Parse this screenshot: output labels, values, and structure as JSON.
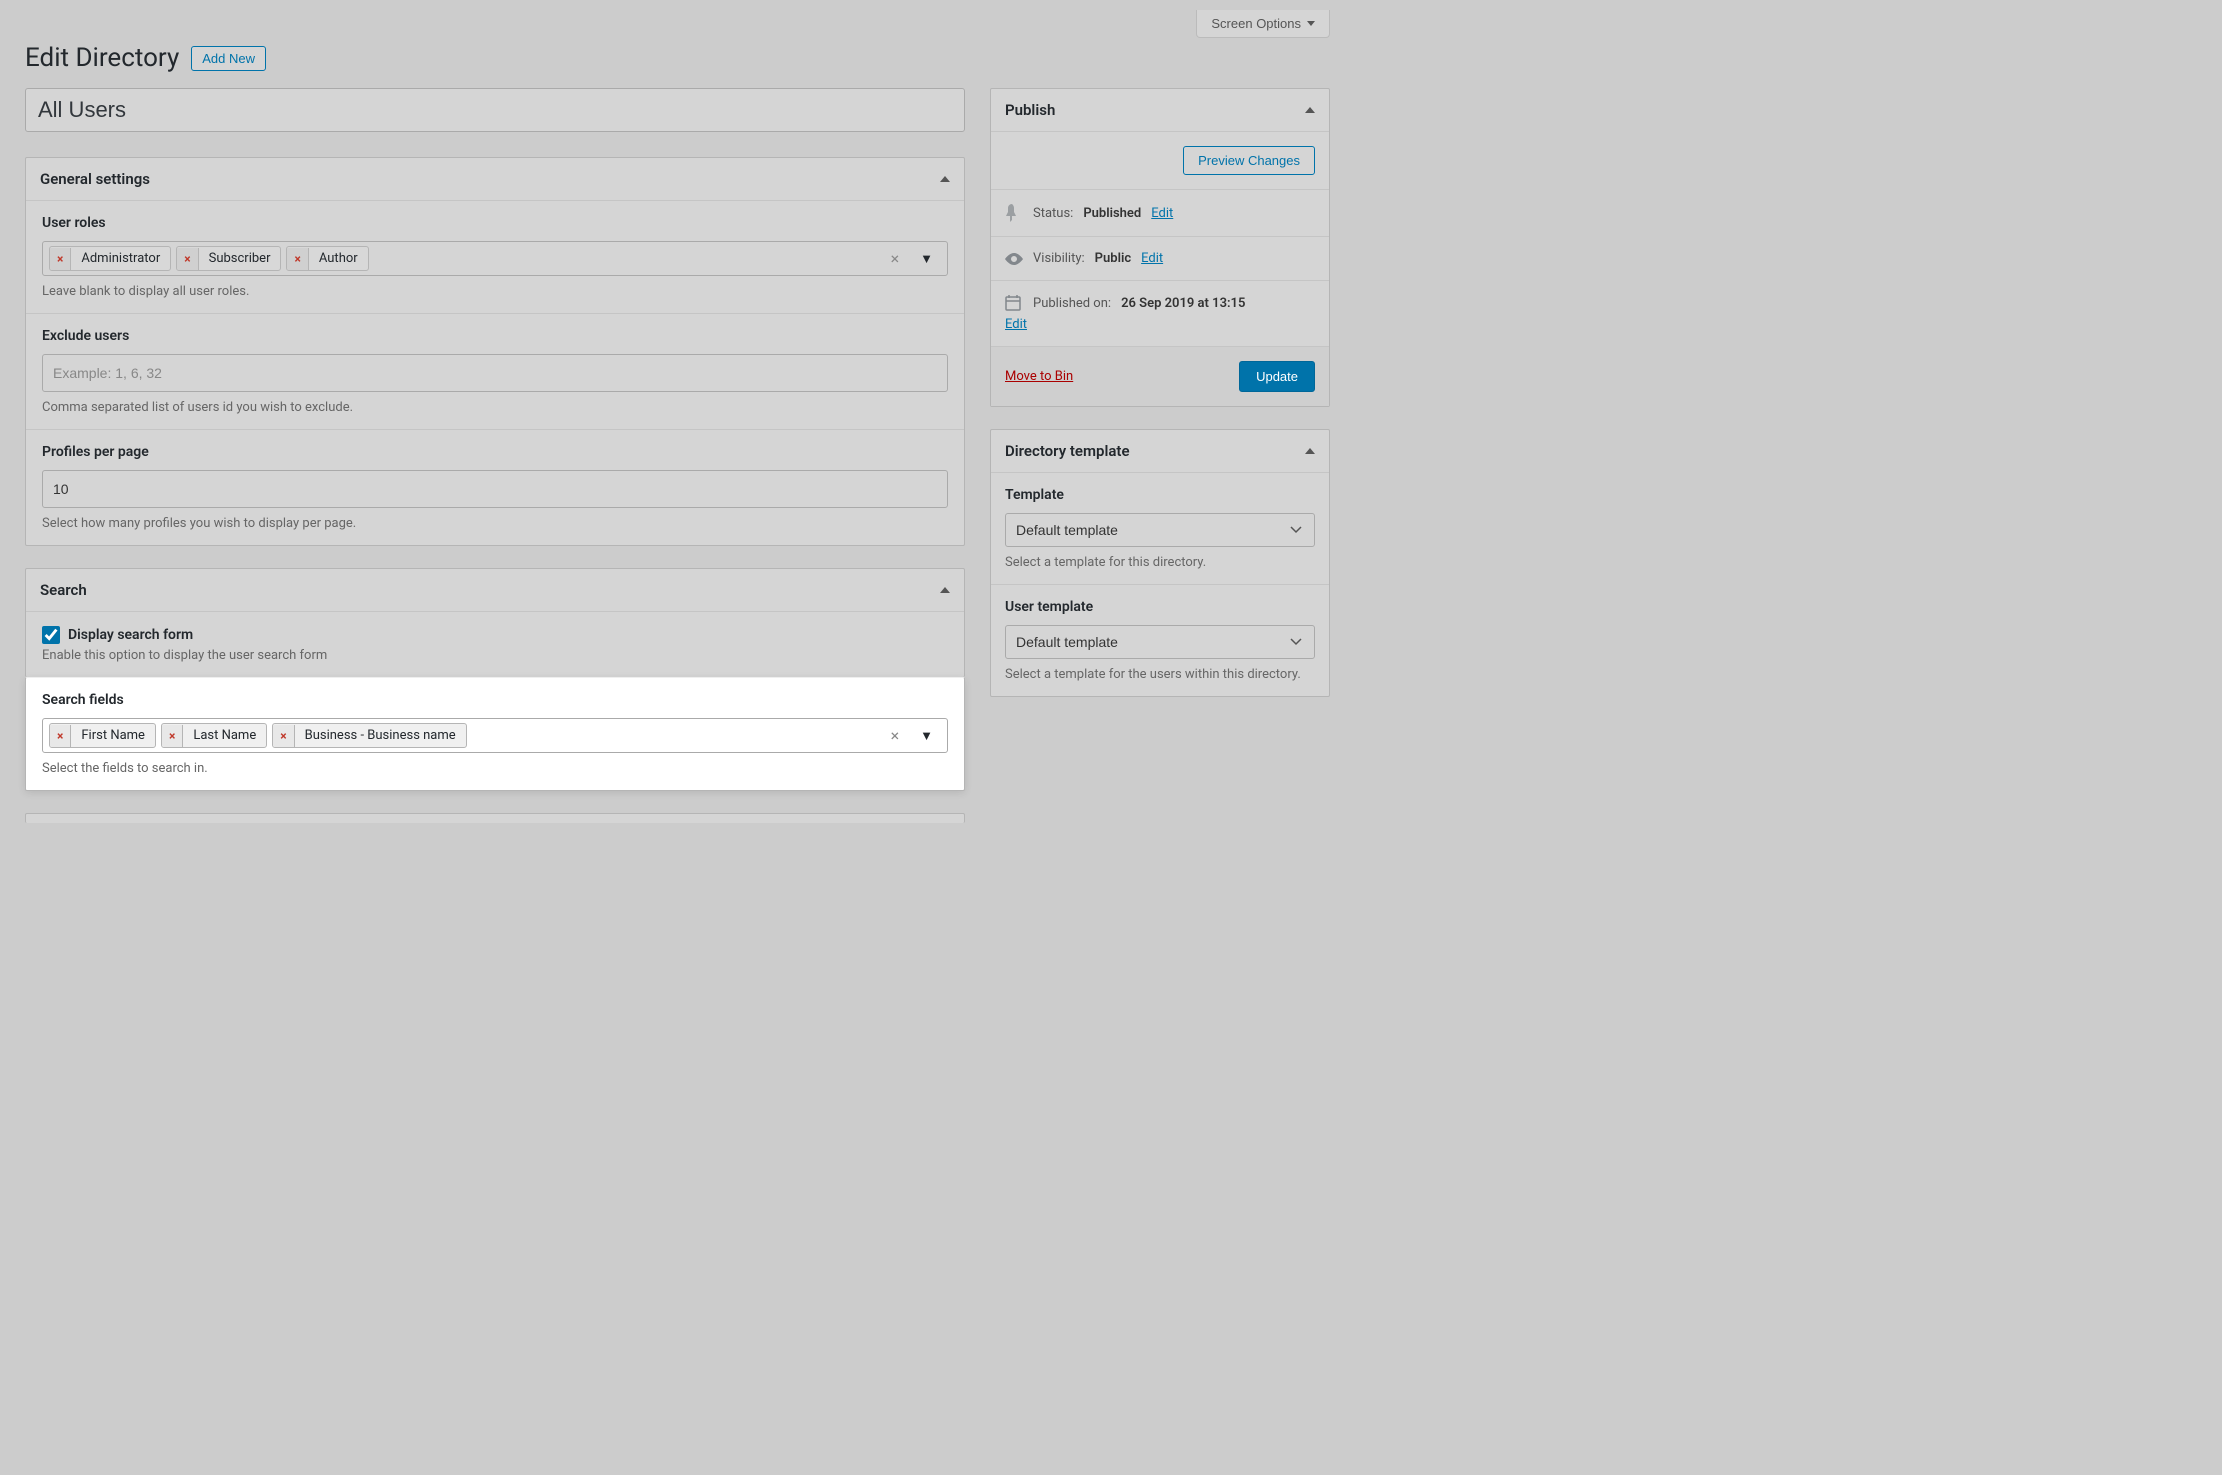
{
  "screen_options": {
    "label": "Screen Options"
  },
  "page_header": {
    "title": "Edit Directory",
    "add_new": "Add New"
  },
  "document_title": "All Users",
  "general_settings": {
    "title": "General settings",
    "user_roles": {
      "label": "User roles",
      "tags": [
        "Administrator",
        "Subscriber",
        "Author"
      ],
      "help": "Leave blank to display all user roles."
    },
    "exclude_users": {
      "label": "Exclude users",
      "placeholder": "Example: 1, 6, 32",
      "value": "",
      "help": "Comma separated list of users id you wish to exclude."
    },
    "profiles_per_page": {
      "label": "Profiles per page",
      "value": "10",
      "help": "Select how many profiles you wish to display per page."
    }
  },
  "search": {
    "title": "Search",
    "display_search_form": {
      "checked": true,
      "label": "Display search form",
      "help": "Enable this option to display the user search form"
    },
    "search_fields": {
      "label": "Search fields",
      "tags": [
        "First Name",
        "Last Name",
        "Business - Business name"
      ],
      "help": "Select the fields to search in."
    }
  },
  "publish": {
    "title": "Publish",
    "preview_changes": "Preview Changes",
    "status_label": "Status:",
    "status_value": "Published",
    "visibility_label": "Visibility:",
    "visibility_value": "Public",
    "published_on_label": "Published on:",
    "published_on_value": "26 Sep 2019 at 13:15",
    "edit": "Edit",
    "move_to_bin": "Move to Bin",
    "update": "Update"
  },
  "directory_template": {
    "title": "Directory template",
    "template_label": "Template",
    "template_value": "Default template",
    "template_help": "Select a template for this directory.",
    "user_template_label": "User template",
    "user_template_value": "Default template",
    "user_template_help": "Select a template for the users within this directory."
  }
}
